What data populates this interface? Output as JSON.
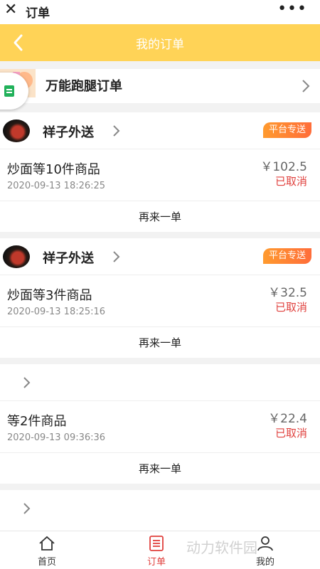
{
  "topbar": {
    "title": "订单",
    "close_glyph": "✕",
    "more_glyph": "•••"
  },
  "header": {
    "title": "我的订单"
  },
  "errand": {
    "label": "万能跑腿订单"
  },
  "orders": [
    {
      "shop": "祥子外送",
      "tag": "平台专送",
      "items": "炒面等10件商品",
      "time": "2020-09-13 18:26:25",
      "price": "￥102.5",
      "status": "已取消",
      "reorder": "再来一单"
    },
    {
      "shop": "祥子外送",
      "tag": "平台专送",
      "items": "炒面等3件商品",
      "time": "2020-09-13 18:25:16",
      "price": "￥32.5",
      "status": "已取消",
      "reorder": "再来一单"
    },
    {
      "shop": "",
      "tag": "",
      "items": "等2件商品",
      "time": "2020-09-13 09:36:36",
      "price": "￥22.4",
      "status": "已取消",
      "reorder": "再来一单"
    }
  ],
  "tabs": [
    {
      "label": "首页",
      "icon": "home-icon"
    },
    {
      "label": "订单",
      "icon": "order-list-icon",
      "active": true
    },
    {
      "label": "我的",
      "icon": "user-icon"
    }
  ],
  "colors": {
    "header": "#ffd357",
    "accent": "#e0403d",
    "tag": "#ff7a33"
  },
  "watermark": "动力软件园"
}
